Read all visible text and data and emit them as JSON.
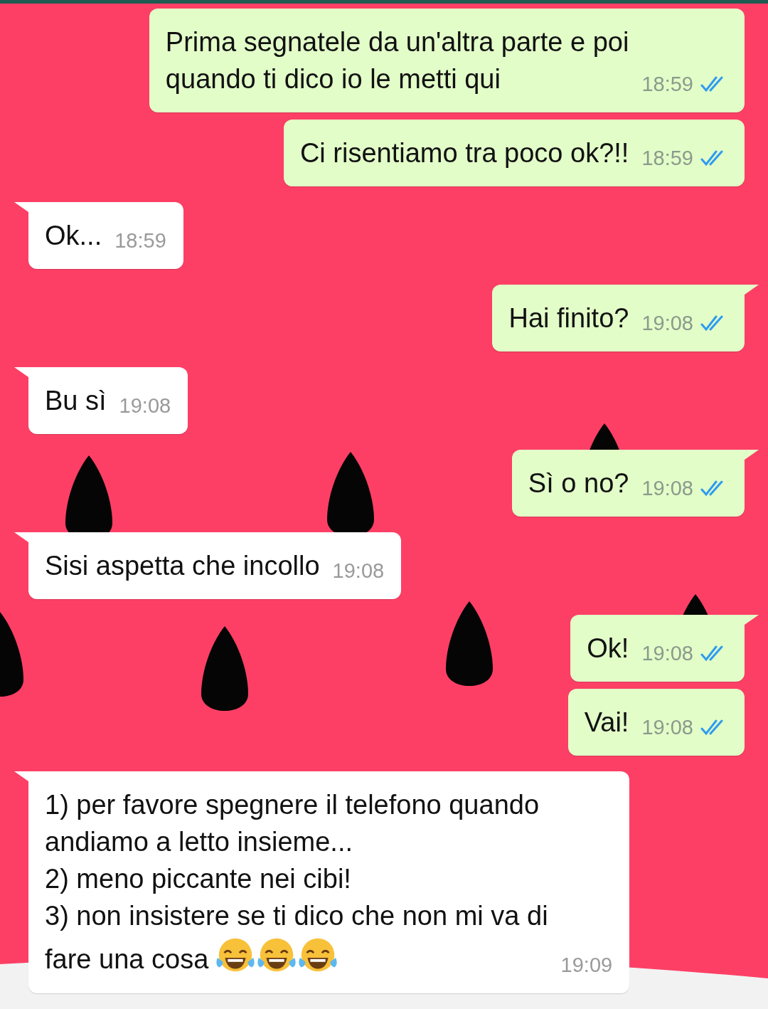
{
  "messages": [
    {
      "kind": "sent",
      "tail": false,
      "text": "Prima segnatele da un'altra parte e poi\nquando ti dico io le metti qui",
      "time": "18:59",
      "read": true
    },
    {
      "kind": "sent",
      "tail": false,
      "text": "Ci risentiamo tra poco ok?!!",
      "time": "18:59",
      "read": true
    },
    {
      "kind": "received",
      "tail": true,
      "text": "Ok...",
      "time": "18:59"
    },
    {
      "kind": "sent",
      "tail": true,
      "text": "Hai finito?",
      "time": "19:08",
      "read": true
    },
    {
      "kind": "received",
      "tail": true,
      "text": "Bu sì",
      "time": "19:08"
    },
    {
      "kind": "sent",
      "tail": true,
      "text": "Sì o no?",
      "time": "19:08",
      "read": true
    },
    {
      "kind": "received",
      "tail": true,
      "text": "Sisi aspetta che incollo",
      "time": "19:08"
    },
    {
      "kind": "sent",
      "tail": true,
      "text": "Ok!",
      "time": "19:08",
      "read": true
    },
    {
      "kind": "sent",
      "tail": false,
      "text": "Vai!",
      "time": "19:08",
      "read": true
    },
    {
      "kind": "received",
      "tail": true,
      "text": "1) per favore spegnere il telefono quando\nandiamo a letto insieme...\n2) meno piccante nei cibi!\n3) non insistere se ti dico che non mi va di\nfare una cosa",
      "emojis": [
        {
          "kind": "laughing-tears"
        },
        {
          "kind": "laughing-tears"
        },
        {
          "kind": "laughing-tears"
        }
      ],
      "time": "19:09"
    }
  ]
}
